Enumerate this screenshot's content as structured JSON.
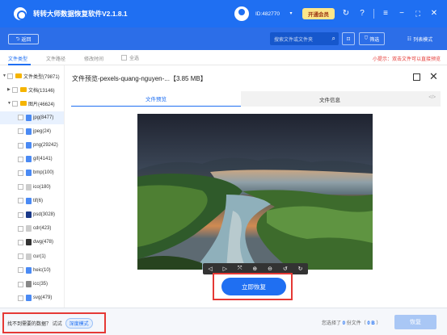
{
  "app": {
    "title": "转转大师数据恢复软件V2.1.8.1",
    "user_id": "ID:482770",
    "vip_label": "开通会员"
  },
  "toolbar": {
    "back_label": "返回",
    "search_placeholder": "搜索文件或文件夹",
    "filter_label": "筛选",
    "list_mode_label": "列表模式"
  },
  "filter_row": {
    "tabs": [
      "文件类型",
      "文件路径",
      "修改时间"
    ],
    "select_all": "全选",
    "tip": "小提示：双击文件可以直接预览"
  },
  "tree": {
    "items": [
      {
        "label": "文件类型(79871)",
        "level": 0,
        "expanded": true,
        "icon_color": "#f5b400"
      },
      {
        "label": "文档(13146)",
        "level": 1,
        "expanded": false,
        "icon_color": "#f5b400"
      },
      {
        "label": "图片(46624)",
        "level": 1,
        "expanded": true,
        "icon_color": "#f5b400"
      },
      {
        "label": "jpg(8477)",
        "level": 2,
        "selected": true,
        "icon_color": "#4a8af4"
      },
      {
        "label": "jpeg(24)",
        "level": 2,
        "icon_color": "#4a8af4"
      },
      {
        "label": "png(29242)",
        "level": 2,
        "icon_color": "#4a8af4"
      },
      {
        "label": "gif(4141)",
        "level": 2,
        "icon_color": "#4a8af4"
      },
      {
        "label": "bmp(100)",
        "level": 2,
        "icon_color": "#4a8af4"
      },
      {
        "label": "ico(180)",
        "level": 2,
        "icon_color": "#cccccc"
      },
      {
        "label": "tif(6)",
        "level": 2,
        "icon_color": "#4a8af4"
      },
      {
        "label": "psd(3028)",
        "level": 2,
        "icon_color": "#1b3a8a"
      },
      {
        "label": "cdr(423)",
        "level": 2,
        "icon_color": "#cccccc"
      },
      {
        "label": "dwg(478)",
        "level": 2,
        "icon_color": "#333333"
      },
      {
        "label": "cur(1)",
        "level": 2,
        "icon_color": "#cccccc"
      },
      {
        "label": "heic(10)",
        "level": 2,
        "icon_color": "#4a8af4"
      },
      {
        "label": "icc(35)",
        "level": 2,
        "icon_color": "#888888"
      },
      {
        "label": "svg(479)",
        "level": 2,
        "icon_color": "#4a8af4"
      }
    ]
  },
  "preview": {
    "title": "文件预览-pexels-quang-nguyen-...【3.85 MB】",
    "tab_preview": "文件预览",
    "tab_info": "文件信息",
    "code_toggle": "</>",
    "restore_label": "立即恢复"
  },
  "bottom": {
    "deep_prompt": "找不到需要的数据？ 试试",
    "deep_mode_label": "深度模式",
    "selected_prefix": "您选择了",
    "selected_count": "0",
    "selected_mid": "份文件（",
    "selected_size": "0 B",
    "selected_suffix": "）",
    "recover_label": "恢复"
  },
  "colors": {
    "primary": "#1f6ff2",
    "highlight_red": "#e53935"
  }
}
